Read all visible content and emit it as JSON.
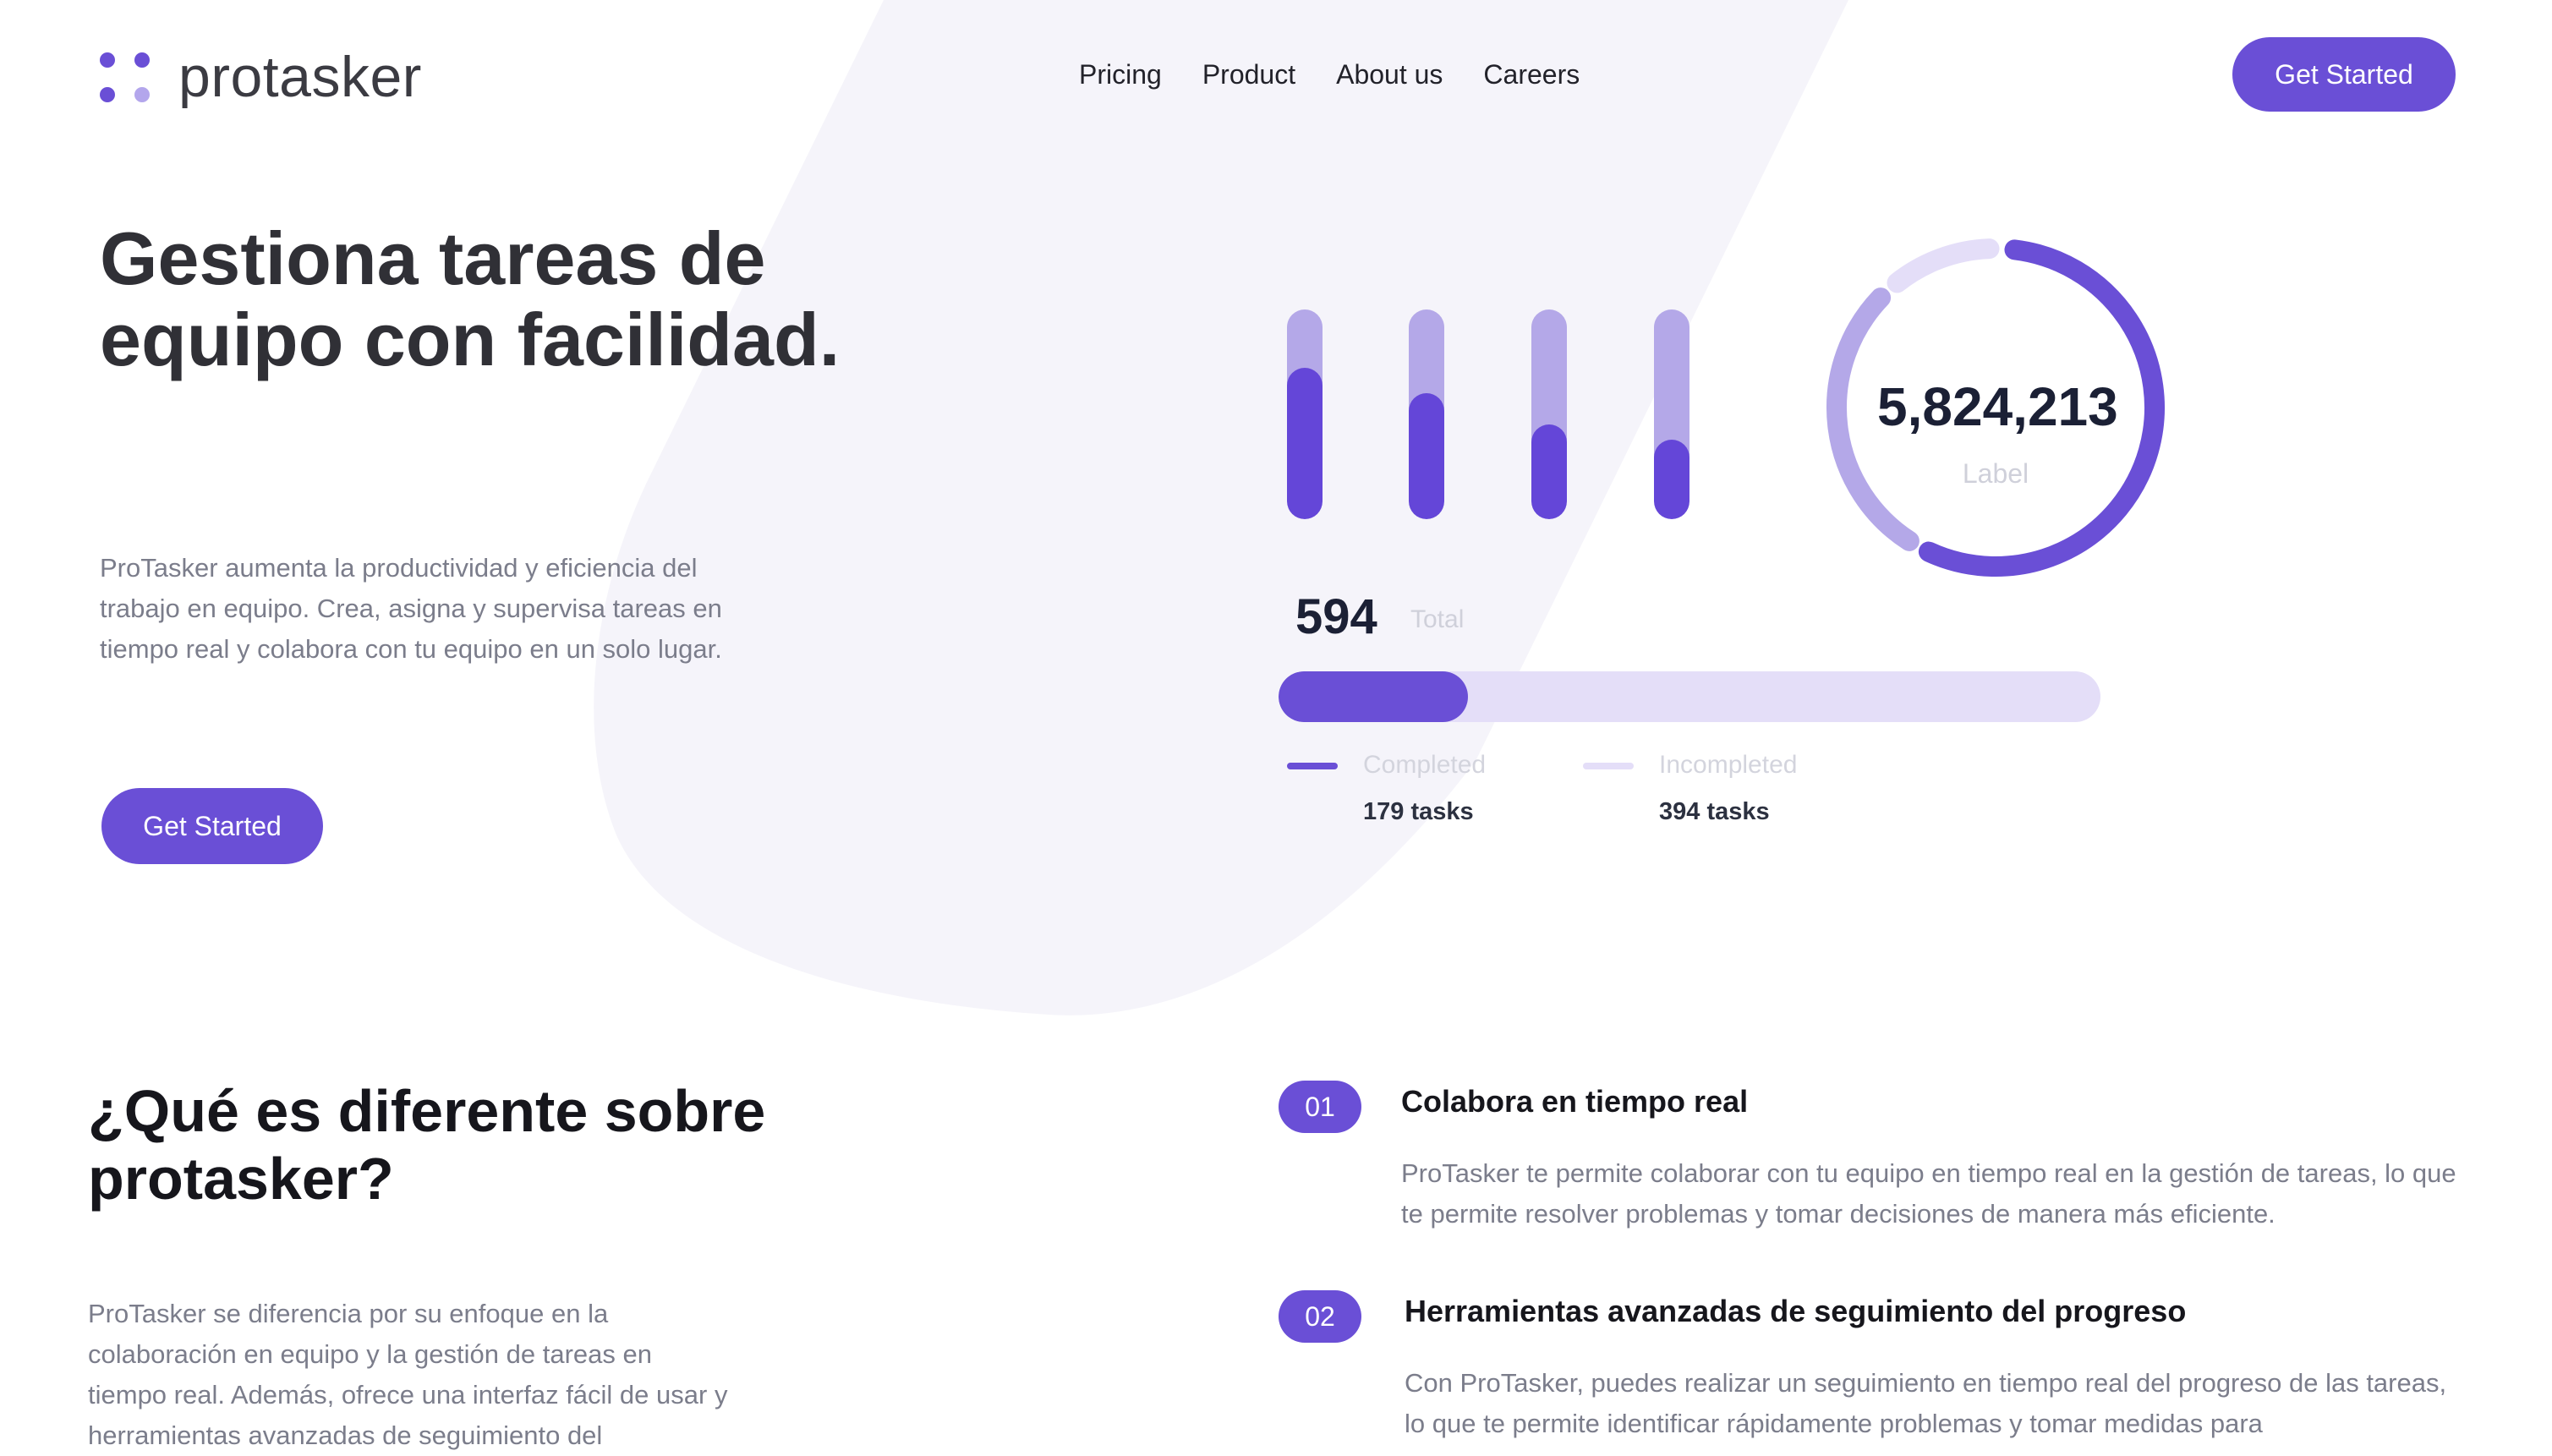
{
  "colors": {
    "accent": "#6a4fd6",
    "accent_light": "#b4a8e8",
    "track": "#e4def8",
    "bg_shape": "#f5f4fa"
  },
  "brand": {
    "name": "protasker"
  },
  "nav": {
    "items": [
      "Pricing",
      "Product",
      "About us",
      "Careers"
    ]
  },
  "header": {
    "cta_label": "Get Started"
  },
  "hero": {
    "title": "Gestiona tareas de equipo con facilidad.",
    "description": "ProTasker aumenta la productividad y eficiencia del trabajo en equipo. Crea, asigna y supervisa tareas en tiempo real y colabora con tu equipo en un solo lugar.",
    "cta_label": "Get Started"
  },
  "stats": {
    "bars": [
      {
        "fill": 0.72
      },
      {
        "fill": 0.6
      },
      {
        "fill": 0.45
      },
      {
        "fill": 0.38
      }
    ],
    "total": {
      "value": "594",
      "label": "Total"
    },
    "progress": {
      "completed_fraction": 0.23
    },
    "legend": [
      {
        "name": "Completed",
        "value": "179 tasks",
        "color": "#6a4fd6"
      },
      {
        "name": "Incompleted",
        "value": "394 tasks",
        "color": "#e4def8"
      }
    ],
    "donut": {
      "value": "5,824,213",
      "label": "Label",
      "segments": [
        {
          "fraction": 0.55,
          "color": "#6a4fd6"
        },
        {
          "fraction": 0.28,
          "color": "#b4a8e8"
        },
        {
          "fraction": 0.1,
          "color": "#e4def8"
        }
      ]
    }
  },
  "difference": {
    "title": "¿Qué es diferente sobre protasker?",
    "description": "ProTasker se diferencia por su enfoque en la colaboración en equipo y la gestión de tareas en tiempo real. Además, ofrece una interfaz fácil de usar y herramientas avanzadas de seguimiento del",
    "features": [
      {
        "number": "01",
        "title": "Colabora en tiempo real",
        "description": "ProTasker te permite colaborar con tu equipo en tiempo real en la gestión de tareas, lo que te permite resolver problemas y tomar decisiones de manera más eficiente."
      },
      {
        "number": "02",
        "title": "Herramientas avanzadas de seguimiento del progreso",
        "description": "Con ProTasker, puedes realizar un seguimiento en tiempo real del progreso de las tareas, lo que te permite identificar rápidamente problemas y tomar medidas para"
      }
    ]
  }
}
